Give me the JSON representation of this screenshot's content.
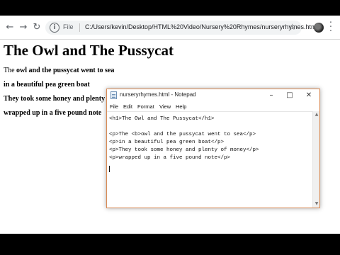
{
  "browser": {
    "scheme_label": "File",
    "url": "C:/Users/kevin/Desktop/HTML%20Video/Nursery%20Rhymes/nurseryrhymes.html",
    "icons": {
      "back": "back-arrow-icon",
      "forward": "forward-arrow-icon",
      "reload": "reload-icon",
      "info": "info-icon",
      "star": "star-icon",
      "menu": "more-menu-icon"
    }
  },
  "page": {
    "heading": "The Owl and The Pussycat",
    "line1_pre": "The ",
    "line1_bold": "owl and the pussycat went to sea",
    "line2": "in a beautiful pea green boat",
    "line3": "They took some honey and plenty of",
    "line4": "wrapped up in a five pound note"
  },
  "notepad": {
    "title": "nurseryrhymes.html - Notepad",
    "menu": [
      "File",
      "Edit",
      "Format",
      "View",
      "Help"
    ],
    "lines": [
      "<h1>The Owl and The Pussycat</h1>",
      "",
      "<p>The <b>owl and the pussycat went to sea</p>",
      "<p>in a beautiful pea green boat</p>",
      "<p>They took some honey and plenty of money</p>",
      "<p>wrapped up in a five pound note</p>"
    ]
  }
}
